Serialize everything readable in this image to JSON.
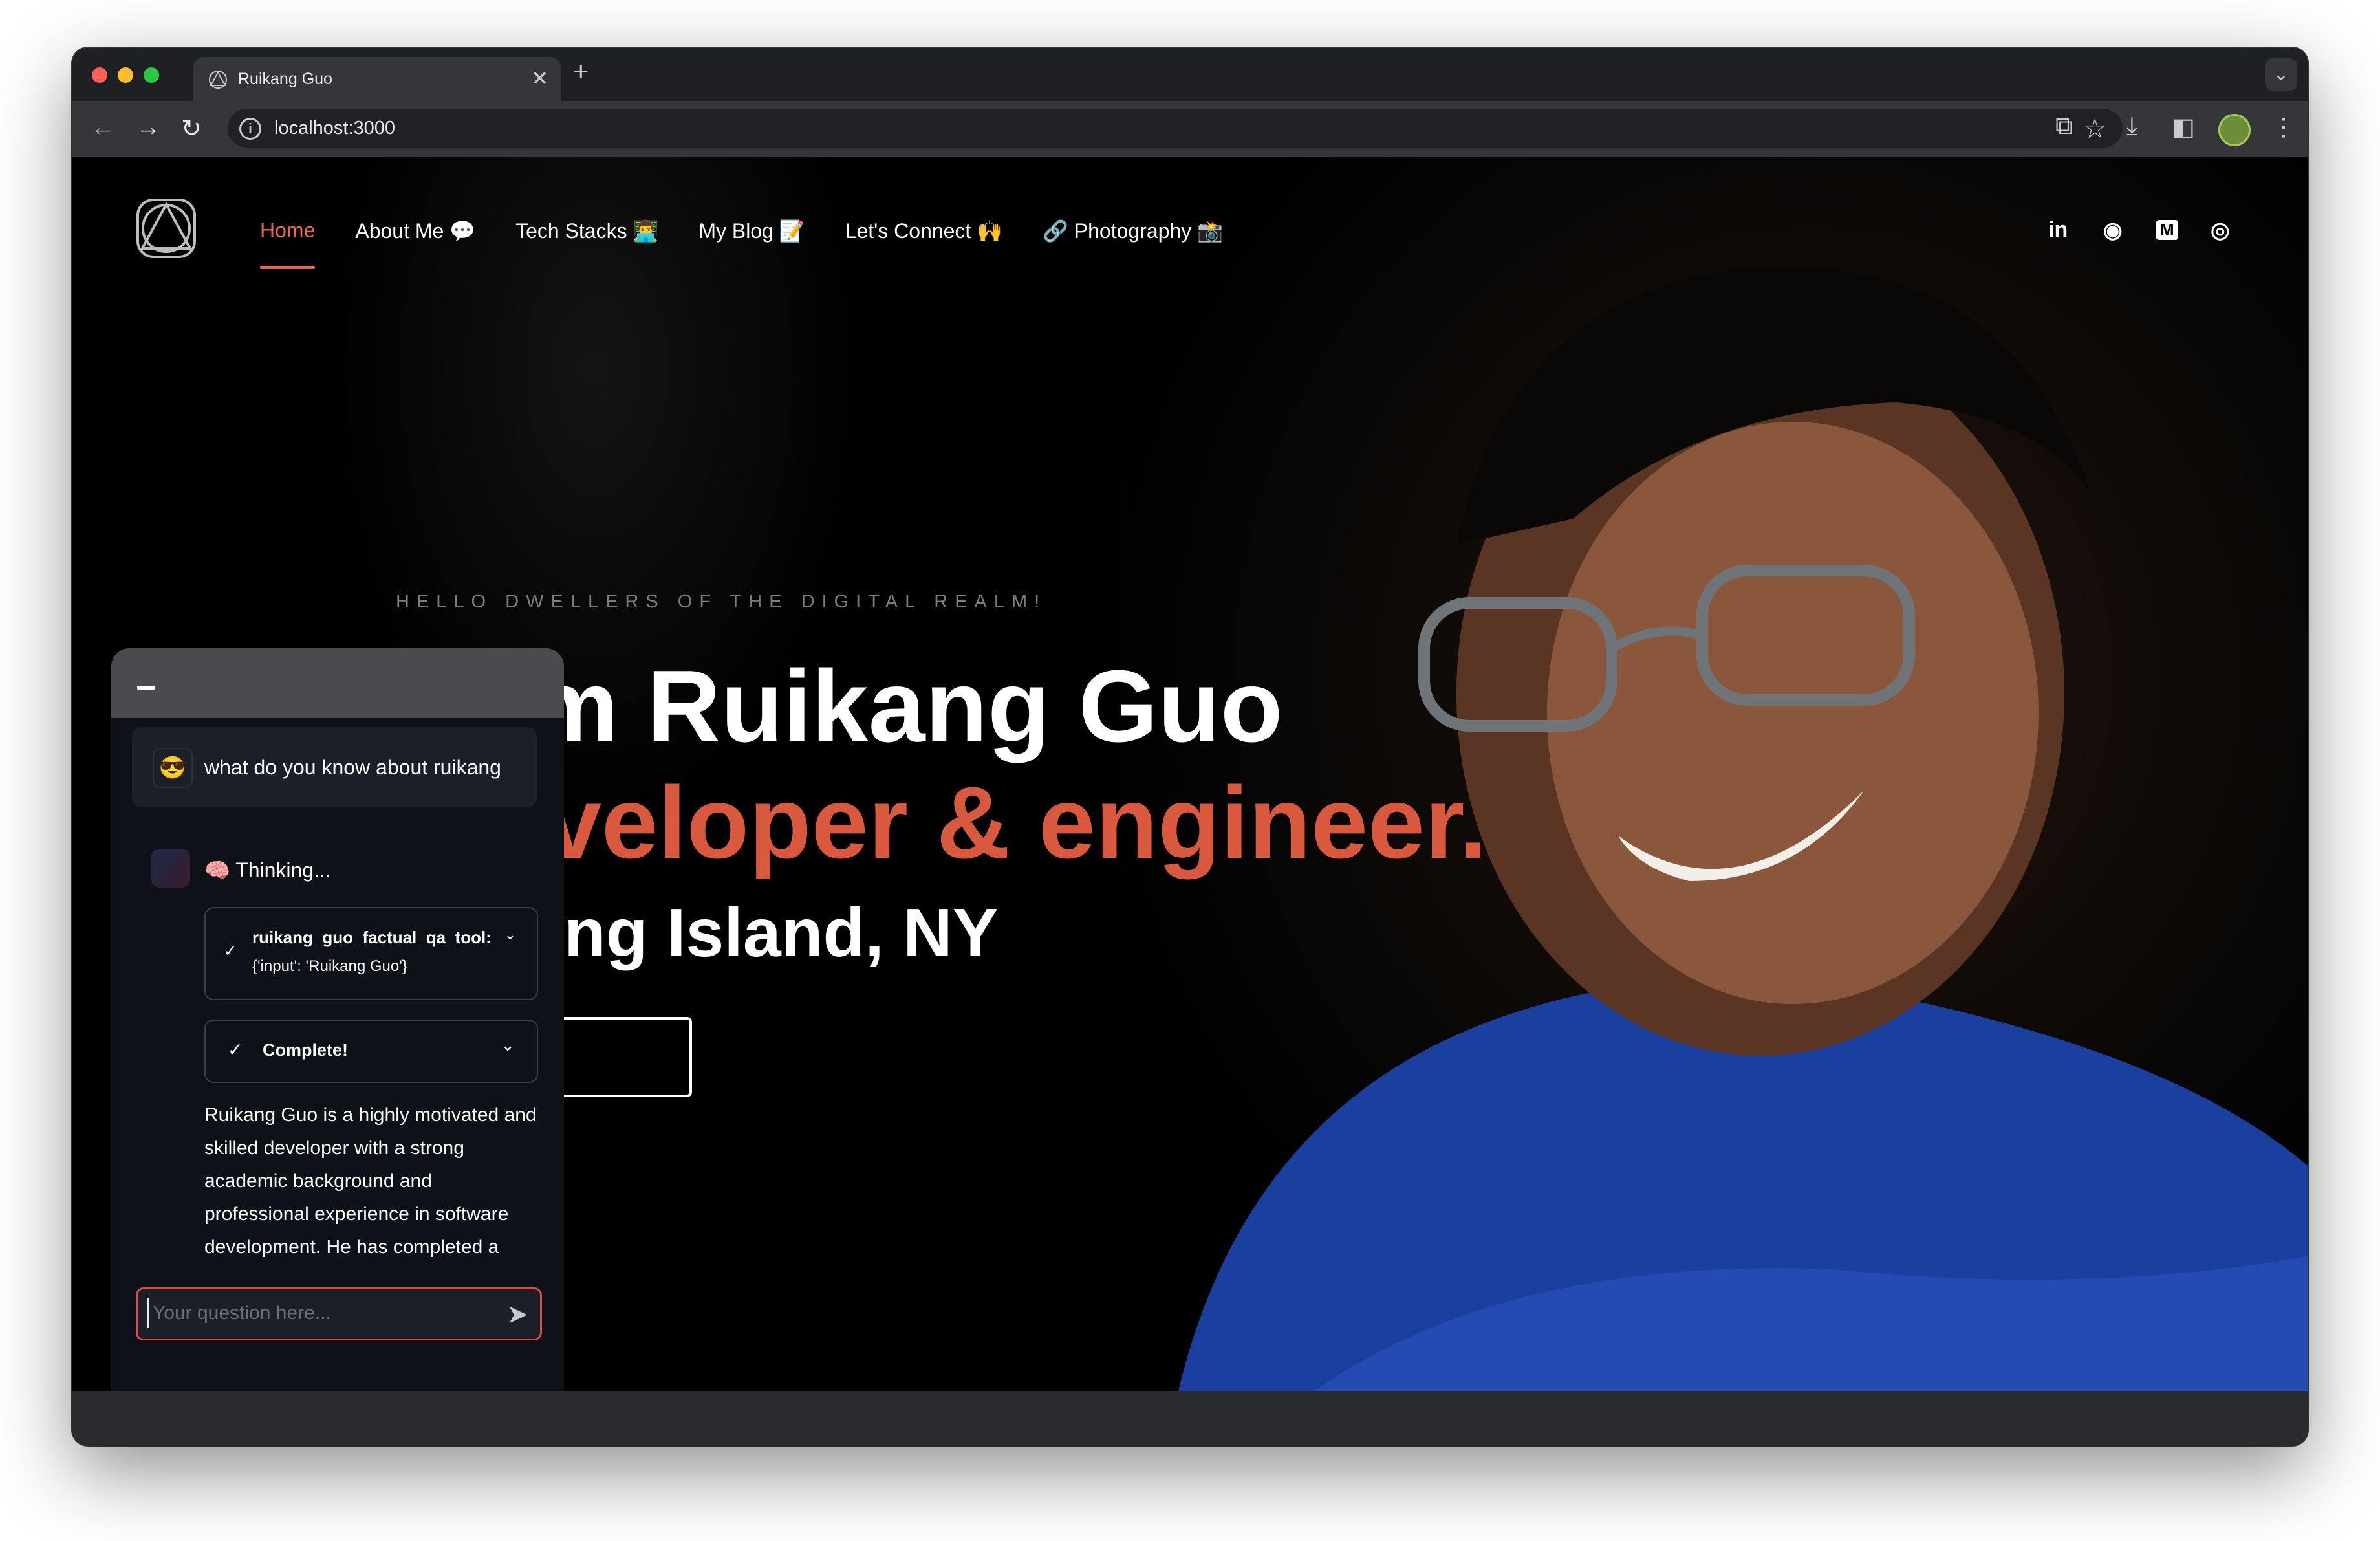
{
  "browser": {
    "tab_title": "Ruikang Guo",
    "tab_close": "✕",
    "new_tab": "+",
    "tab_menu": "⌄",
    "url": "localhost:3000",
    "icons": [
      "back-arrow-icon",
      "forward-arrow-icon",
      "reload-icon",
      "info-icon",
      "star-icon",
      "extensions-icon",
      "download-icon",
      "sidebar-icon",
      "profile-avatar-icon",
      "more-menu-icon"
    ]
  },
  "nav": {
    "items": [
      {
        "label": "Home",
        "active": true
      },
      {
        "label": "About Me 💬",
        "active": false
      },
      {
        "label": "Tech Stacks 👨‍💻",
        "active": false
      },
      {
        "label": "My Blog 📝",
        "active": false
      },
      {
        "label": "Let's Connect 🙌",
        "active": false
      },
      {
        "label": "🔗 Photography 📸",
        "active": false
      }
    ],
    "social": {
      "linkedin": "in",
      "github": "◉",
      "medium": "M",
      "instagram": "◎"
    }
  },
  "hero": {
    "subtitle": "HELLO DWELLERS OF THE DIGITAL REALM!",
    "name_line": "’m Ruikang Guo",
    "role_line": "veloper & engineer.",
    "location_line": "ng Island, NY"
  },
  "chat": {
    "user_avatar": "😎",
    "user_message": "what do you know about ruikang",
    "thinking_label": "🧠 Thinking...",
    "tool_name": "ruikang_guo_factual_qa_tool:",
    "tool_input": "{'input': 'Ruikang Guo'}",
    "complete_label": "Complete!",
    "answer_lines": [
      "Ruikang Guo is a highly motivated and",
      "skilled developer with a strong",
      "academic background and",
      "professional experience in software",
      "development. He has completed a"
    ],
    "input_placeholder": "Your question here..."
  },
  "colors": {
    "accent": "#e8674a",
    "role_text": "#d9593f",
    "chat_bg": "#0e1117",
    "input_border": "#e04a4a"
  }
}
